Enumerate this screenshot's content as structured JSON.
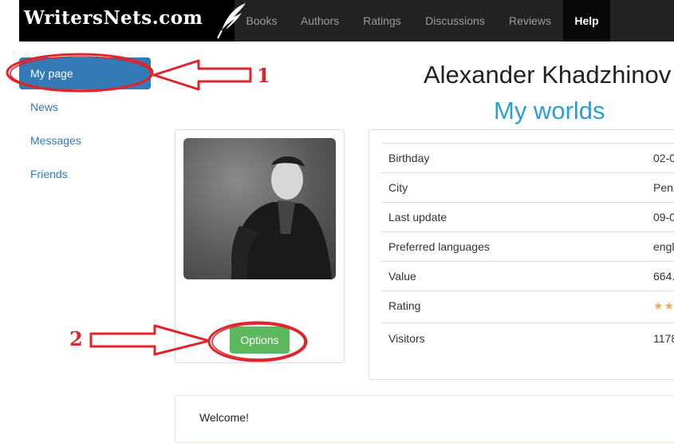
{
  "brand": {
    "name": "WritersNets.com",
    "logo_icon": "quill-icon"
  },
  "nav": {
    "items": [
      {
        "label": "Books"
      },
      {
        "label": "Authors"
      },
      {
        "label": "Ratings"
      },
      {
        "label": "Discussions"
      },
      {
        "label": "Reviews"
      },
      {
        "label": "Help",
        "active": true
      }
    ]
  },
  "sidebar": {
    "items": [
      {
        "label": "My page",
        "active": true
      },
      {
        "label": "News"
      },
      {
        "label": "Messages"
      },
      {
        "label": "Friends"
      }
    ]
  },
  "profile": {
    "name": "Alexander Khadzhinov",
    "subtitle": "My worlds",
    "options_label": "Options"
  },
  "info": {
    "rows": [
      {
        "key": "Birthday",
        "value": "02-0"
      },
      {
        "key": "City",
        "value": "Penz"
      },
      {
        "key": "Last update",
        "value": "09-0"
      },
      {
        "key": "Preferred languages",
        "value": "engl"
      },
      {
        "key": "Value",
        "value": "664."
      },
      {
        "key": "Rating",
        "value": "★★"
      },
      {
        "key": "Visitors",
        "value": "1178"
      }
    ]
  },
  "welcome": {
    "text": "Welcome!"
  },
  "annotations": {
    "marker_1": "1",
    "marker_2": "2",
    "color": "#e0242b"
  },
  "colors": {
    "accent": "#337ab7",
    "title_blue": "#2a9fd6",
    "button_green": "#5cb85c",
    "nav_bg": "#222222"
  }
}
